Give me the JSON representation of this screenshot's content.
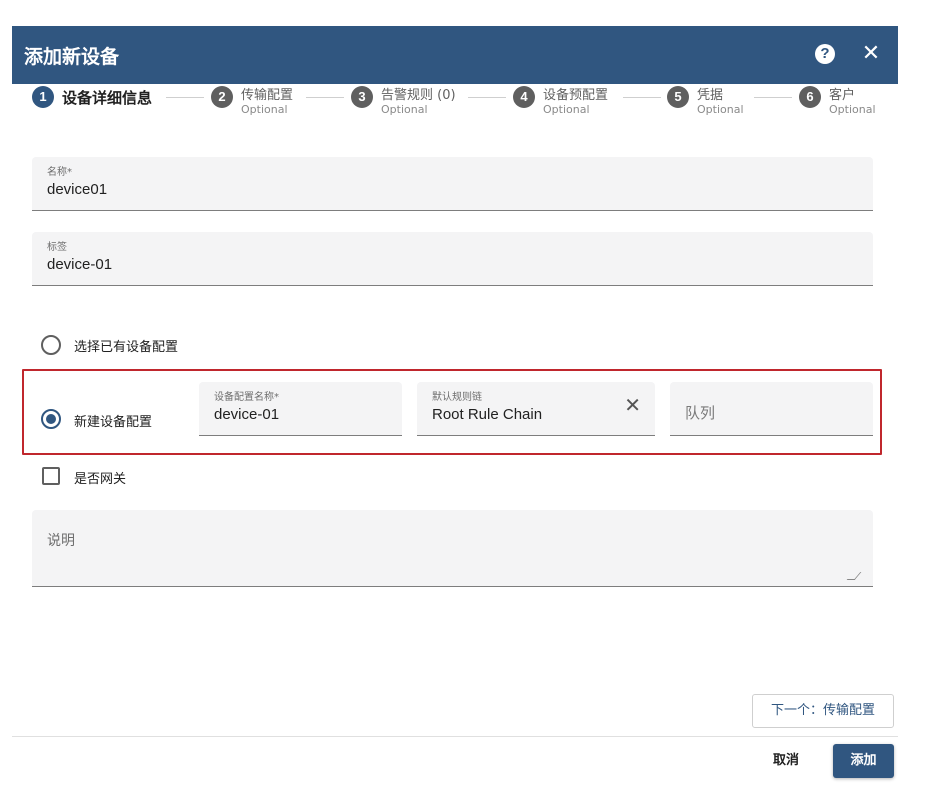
{
  "dialog": {
    "title": "添加新设备",
    "help_icon": "help-circle-icon",
    "close_icon": "close-icon"
  },
  "stepper": {
    "steps": [
      {
        "number": "1",
        "label": "设备详细信息",
        "optional": ""
      },
      {
        "number": "2",
        "label": "传输配置",
        "optional": "Optional"
      },
      {
        "number": "3",
        "label": "告警规则 (0)",
        "optional": "Optional"
      },
      {
        "number": "4",
        "label": "设备预配置",
        "optional": "Optional"
      },
      {
        "number": "5",
        "label": "凭据",
        "optional": "Optional"
      },
      {
        "number": "6",
        "label": "客户",
        "optional": "Optional"
      }
    ]
  },
  "form": {
    "name": {
      "label": "名称*",
      "value": "device01"
    },
    "label": {
      "label": "标签",
      "value": "device-01"
    },
    "profile_existing_label": "选择已有设备配置",
    "profile_new_label": "新建设备配置",
    "profile_name": {
      "label": "设备配置名称*",
      "value": "device-01"
    },
    "rule_chain": {
      "label": "默认规则链",
      "value": "Root Rule Chain"
    },
    "queue": {
      "placeholder": "队列"
    },
    "gateway_label": "是否网关",
    "description": {
      "placeholder": "说明"
    }
  },
  "colors": {
    "primary": "#305680",
    "highlight": "#c0272d"
  },
  "actions": {
    "next_label": "下一个：传输配置",
    "cancel_label": "取消",
    "add_label": "添加"
  }
}
